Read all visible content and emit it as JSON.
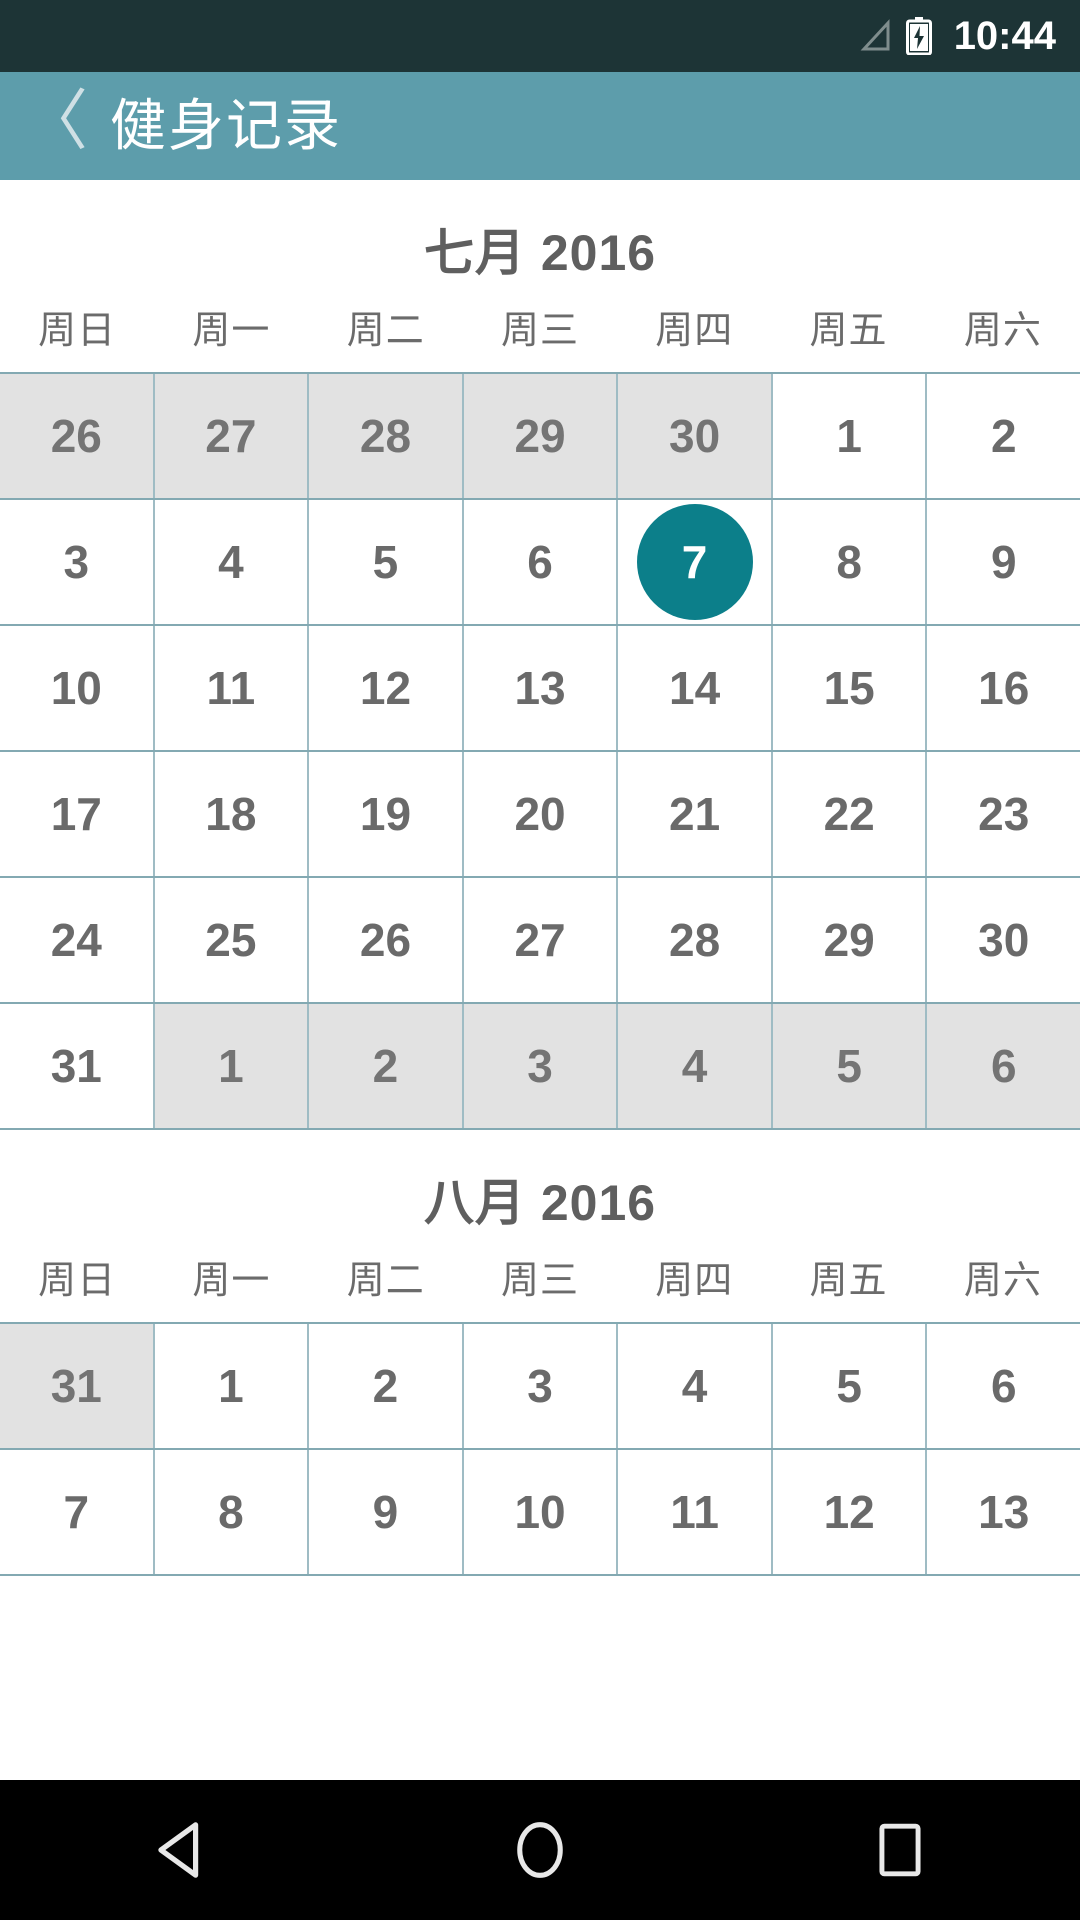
{
  "status_bar": {
    "time": "10:44",
    "signal_icon": "signal-triangle-icon",
    "battery_icon": "battery-charging-icon",
    "background_color": "#1d3436"
  },
  "app_bar": {
    "back_label": "〈",
    "title": "健身记录",
    "background_color": "#5d9dab",
    "title_color": "#ffffff"
  },
  "theme": {
    "accent_color": "#0c7f8a",
    "grid_line_color": "#9fbcc4",
    "adjacent_day_background": "#e2e2e2",
    "day_text_color": "#6a6a6a"
  },
  "months": [
    {
      "title": "七月 2016",
      "weekdays": [
        "周日",
        "周一",
        "周二",
        "周三",
        "周四",
        "周五",
        "周六"
      ],
      "weeks": [
        [
          {
            "day": "26",
            "adjacent": true,
            "selected": false
          },
          {
            "day": "27",
            "adjacent": true,
            "selected": false
          },
          {
            "day": "28",
            "adjacent": true,
            "selected": false
          },
          {
            "day": "29",
            "adjacent": true,
            "selected": false
          },
          {
            "day": "30",
            "adjacent": true,
            "selected": false
          },
          {
            "day": "1",
            "adjacent": false,
            "selected": false
          },
          {
            "day": "2",
            "adjacent": false,
            "selected": false
          }
        ],
        [
          {
            "day": "3",
            "adjacent": false,
            "selected": false
          },
          {
            "day": "4",
            "adjacent": false,
            "selected": false
          },
          {
            "day": "5",
            "adjacent": false,
            "selected": false
          },
          {
            "day": "6",
            "adjacent": false,
            "selected": false
          },
          {
            "day": "7",
            "adjacent": false,
            "selected": true
          },
          {
            "day": "8",
            "adjacent": false,
            "selected": false
          },
          {
            "day": "9",
            "adjacent": false,
            "selected": false
          }
        ],
        [
          {
            "day": "10",
            "adjacent": false,
            "selected": false
          },
          {
            "day": "11",
            "adjacent": false,
            "selected": false
          },
          {
            "day": "12",
            "adjacent": false,
            "selected": false
          },
          {
            "day": "13",
            "adjacent": false,
            "selected": false
          },
          {
            "day": "14",
            "adjacent": false,
            "selected": false
          },
          {
            "day": "15",
            "adjacent": false,
            "selected": false
          },
          {
            "day": "16",
            "adjacent": false,
            "selected": false
          }
        ],
        [
          {
            "day": "17",
            "adjacent": false,
            "selected": false
          },
          {
            "day": "18",
            "adjacent": false,
            "selected": false
          },
          {
            "day": "19",
            "adjacent": false,
            "selected": false
          },
          {
            "day": "20",
            "adjacent": false,
            "selected": false
          },
          {
            "day": "21",
            "adjacent": false,
            "selected": false
          },
          {
            "day": "22",
            "adjacent": false,
            "selected": false
          },
          {
            "day": "23",
            "adjacent": false,
            "selected": false
          }
        ],
        [
          {
            "day": "24",
            "adjacent": false,
            "selected": false
          },
          {
            "day": "25",
            "adjacent": false,
            "selected": false
          },
          {
            "day": "26",
            "adjacent": false,
            "selected": false
          },
          {
            "day": "27",
            "adjacent": false,
            "selected": false
          },
          {
            "day": "28",
            "adjacent": false,
            "selected": false
          },
          {
            "day": "29",
            "adjacent": false,
            "selected": false
          },
          {
            "day": "30",
            "adjacent": false,
            "selected": false
          }
        ],
        [
          {
            "day": "31",
            "adjacent": false,
            "selected": false
          },
          {
            "day": "1",
            "adjacent": true,
            "selected": false
          },
          {
            "day": "2",
            "adjacent": true,
            "selected": false
          },
          {
            "day": "3",
            "adjacent": true,
            "selected": false
          },
          {
            "day": "4",
            "adjacent": true,
            "selected": false
          },
          {
            "day": "5",
            "adjacent": true,
            "selected": false
          },
          {
            "day": "6",
            "adjacent": true,
            "selected": false
          }
        ]
      ]
    },
    {
      "title": "八月 2016",
      "weekdays": [
        "周日",
        "周一",
        "周二",
        "周三",
        "周四",
        "周五",
        "周六"
      ],
      "weeks": [
        [
          {
            "day": "31",
            "adjacent": true,
            "selected": false
          },
          {
            "day": "1",
            "adjacent": false,
            "selected": false
          },
          {
            "day": "2",
            "adjacent": false,
            "selected": false
          },
          {
            "day": "3",
            "adjacent": false,
            "selected": false
          },
          {
            "day": "4",
            "adjacent": false,
            "selected": false
          },
          {
            "day": "5",
            "adjacent": false,
            "selected": false
          },
          {
            "day": "6",
            "adjacent": false,
            "selected": false
          }
        ],
        [
          {
            "day": "7",
            "adjacent": false,
            "selected": false
          },
          {
            "day": "8",
            "adjacent": false,
            "selected": false
          },
          {
            "day": "9",
            "adjacent": false,
            "selected": false
          },
          {
            "day": "10",
            "adjacent": false,
            "selected": false
          },
          {
            "day": "11",
            "adjacent": false,
            "selected": false
          },
          {
            "day": "12",
            "adjacent": false,
            "selected": false
          },
          {
            "day": "13",
            "adjacent": false,
            "selected": false
          }
        ]
      ]
    }
  ],
  "nav_bar": {
    "back_icon": "nav-back-triangle-icon",
    "home_icon": "nav-home-circle-icon",
    "recents_icon": "nav-recents-square-icon",
    "background_color": "#000000"
  }
}
